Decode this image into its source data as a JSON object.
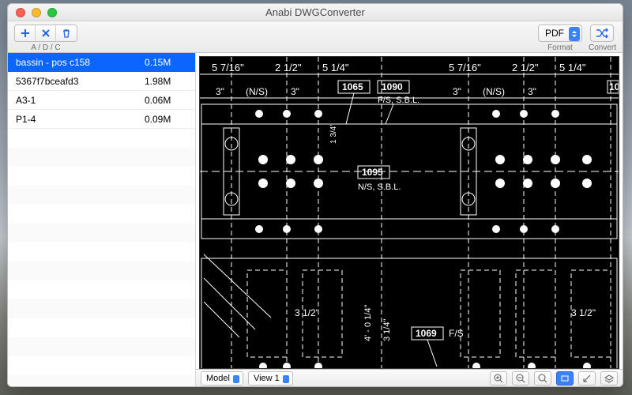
{
  "window": {
    "title": "Anabi DWGConverter"
  },
  "toolbar": {
    "add_delete_clear_label": "A / D / C",
    "format_label": "Format",
    "format_value": "PDF",
    "convert_label": "Convert"
  },
  "files": [
    {
      "name": "bassin - pos c158",
      "size": "0.15M",
      "selected": true
    },
    {
      "name": "5367f7bceafd3",
      "size": "1.98M",
      "selected": false
    },
    {
      "name": "A3-1",
      "size": "0.06M",
      "selected": false
    },
    {
      "name": "P1-4",
      "size": "0.09M",
      "selected": false
    }
  ],
  "bottombar": {
    "space": "Model",
    "view": "View 1"
  },
  "drawing": {
    "dim_5_7_16": "5 7/16\"",
    "dim_2_1_2": "2 1/2\"",
    "dim_5_1_4": "5 1/4\"",
    "dim_3": "3\"",
    "ns": "(N/S)",
    "dim_1_3_4": "1 3/4\"",
    "lbl_1065": "1065",
    "lbl_1090": "1090",
    "fs_sbl": "F/S, S.B.L.",
    "lbl_1095": "1095",
    "ns_sbl": "N/S, S.B.L.",
    "dim_3_1_2": "3 1/2\"",
    "dim_4_0_1_4": "4' - 0 1/4\"",
    "dim_3_1_4": "3 1/4\"",
    "lbl_1069": "1069",
    "fs": "F/S",
    "lbl_10_cut": "10"
  }
}
